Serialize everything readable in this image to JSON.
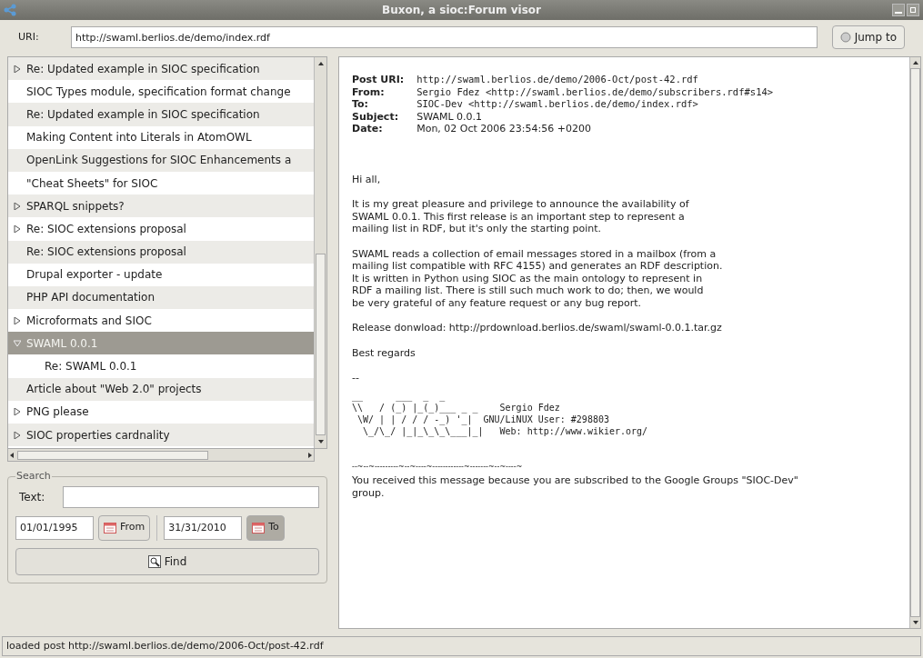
{
  "window": {
    "title": "Buxon, a sioc:Forum visor"
  },
  "uri_bar": {
    "label": "URI:",
    "value": "http://swaml.berlios.de/demo/index.rdf",
    "button": "Jump to"
  },
  "thread_tree": {
    "items": [
      {
        "label": "Re: Updated example in SIOC specification",
        "kind": "thread",
        "expanded": false,
        "selected": false
      },
      {
        "label": "SIOC Types module, specification format change",
        "kind": "post",
        "selected": false
      },
      {
        "label": "Re: Updated example in SIOC specification",
        "kind": "post",
        "selected": false
      },
      {
        "label": "Making Content into Literals in AtomOWL",
        "kind": "post",
        "selected": false
      },
      {
        "label": "OpenLink Suggestions for SIOC Enhancements a",
        "kind": "post",
        "selected": false
      },
      {
        "label": "\"Cheat Sheets\" for SIOC",
        "kind": "post",
        "selected": false
      },
      {
        "label": "SPARQL snippets?",
        "kind": "thread",
        "expanded": false,
        "selected": false
      },
      {
        "label": "Re: SIOC extensions proposal",
        "kind": "thread",
        "expanded": false,
        "selected": false
      },
      {
        "label": "Re: SIOC extensions proposal",
        "kind": "post",
        "selected": false
      },
      {
        "label": "Drupal exporter - update",
        "kind": "post",
        "selected": false
      },
      {
        "label": "PHP API documentation",
        "kind": "post",
        "selected": false
      },
      {
        "label": "Microformats and SIOC",
        "kind": "thread",
        "expanded": false,
        "selected": false
      },
      {
        "label": "SWAML 0.0.1",
        "kind": "thread",
        "expanded": true,
        "selected": true,
        "children": [
          {
            "label": "Re: SWAML 0.0.1",
            "selected": false
          }
        ]
      },
      {
        "label": "Article about \"Web 2.0\" projects",
        "kind": "post",
        "selected": false
      },
      {
        "label": "PNG please",
        "kind": "thread",
        "expanded": false,
        "selected": false
      },
      {
        "label": "SIOC properties cardnality",
        "kind": "thread",
        "expanded": false,
        "selected": false
      }
    ]
  },
  "search": {
    "title": "Search",
    "text_label": "Text:",
    "from_date": "01/01/1995",
    "from_button": {
      "label": "From",
      "pressed": false
    },
    "to_date": "31/31/2010",
    "to_button": {
      "label": "To",
      "pressed": true
    },
    "find_button": "Find"
  },
  "message": {
    "headers": [
      {
        "label": "Post URI:",
        "value": "http://swaml.berlios.de/demo/2006-Oct/post-42.rdf",
        "monospace": true
      },
      {
        "label": "From:",
        "value": "Sergio Fdez <http://swaml.berlios.de/demo/subscribers.rdf#s14>",
        "monospace": true
      },
      {
        "label": "To:",
        "value": "SIOC-Dev <http://swaml.berlios.de/demo/index.rdf>",
        "monospace": true
      },
      {
        "label": "Subject:",
        "value": "SWAML 0.0.1",
        "monospace": false
      },
      {
        "label": "Date:",
        "value": "Mon, 02 Oct 2006 23:54:56 +0200",
        "monospace": false
      }
    ],
    "paragraphs": [
      {
        "lines": [
          "Hi all,"
        ]
      },
      {
        "lines": [
          "It is my great pleasure and privilege to announce the availability of",
          "SWAML 0.0.1. This first release is an important step to represent a",
          "mailing list in RDF, but it's only the starting point."
        ]
      },
      {
        "lines": [
          "SWAML reads a collection of email messages stored in a mailbox (from a",
          "mailing list compatible with RFC 4155) and generates an RDF description.",
          "It is written in Python using SIOC as the main ontology to represent in",
          "RDF a mailing list. There is still such much work to do; then, we would",
          "be very grateful of any feature request or any bug report."
        ]
      },
      {
        "lines": [
          "Release donwload: http://prdownload.berlios.de/swaml/swaml-0.0.1.tar.gz"
        ]
      },
      {
        "lines": [
          "Best regards"
        ]
      },
      {
        "lines": [
          "--"
        ]
      }
    ],
    "signature": [
      "__      ___  _  _",
      "\\\\   / (_) |_(_)___ _ _    Sergio Fdez",
      " \\W/ | | / / / -_) '_|  GNU/LiNUX User: #298803",
      "  \\_/\\_/ |_|_\\_\\_\\___|_|   Web: http://www.wikier.org/"
    ],
    "separator": "--~--~---------~--~----~------------~-------~--~----~",
    "footer": "You received this message because you are subscribed to the Google Groups \"SIOC-Dev\" group."
  },
  "status_bar": {
    "text": "loaded post http://swaml.berlios.de/demo/2006-Oct/post-42.rdf"
  }
}
